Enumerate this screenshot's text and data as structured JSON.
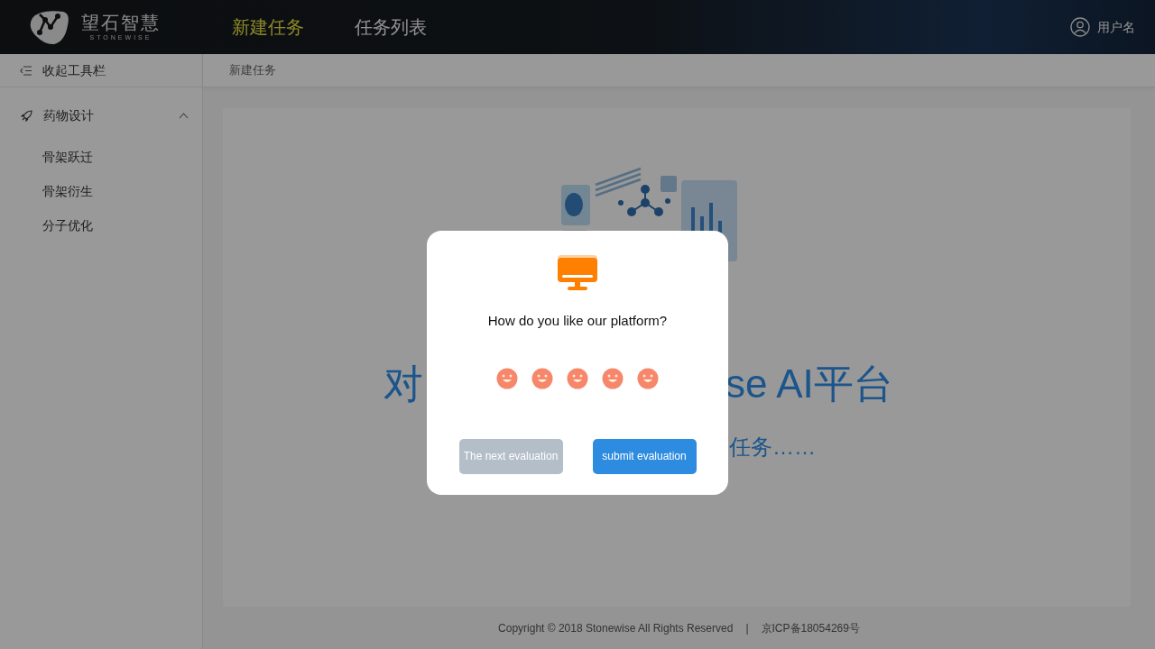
{
  "header": {
    "brand": "望石智慧",
    "brand_sub": "STONEWISE",
    "nav": [
      {
        "label": "新建任务",
        "selected": true
      },
      {
        "label": "任务列表",
        "selected": false
      }
    ],
    "user": "用户名"
  },
  "sidebar": {
    "collapse": "收起工具栏",
    "groups": [
      {
        "label": "药物设计",
        "expanded": true,
        "children": [
          {
            "label": "骨架跃迁"
          },
          {
            "label": "骨架衍生"
          },
          {
            "label": "分子优化"
          }
        ]
      }
    ]
  },
  "breadcrumb": "新建任务",
  "welcome": {
    "title_left": "对",
    "title_right": "se AI平台",
    "subtitle_right": "任务……"
  },
  "footer": {
    "copyright": "Copyright © 2018 Stonewise All Rights Reserved",
    "separator": "|",
    "icp": "京ICP备18054269号"
  },
  "dialog": {
    "question": "How do you like our platform?",
    "stars": 5,
    "buttons": [
      {
        "label": "The next evaluation",
        "kind": "secondary"
      },
      {
        "label": "submit evaluation",
        "kind": "primary"
      }
    ]
  }
}
